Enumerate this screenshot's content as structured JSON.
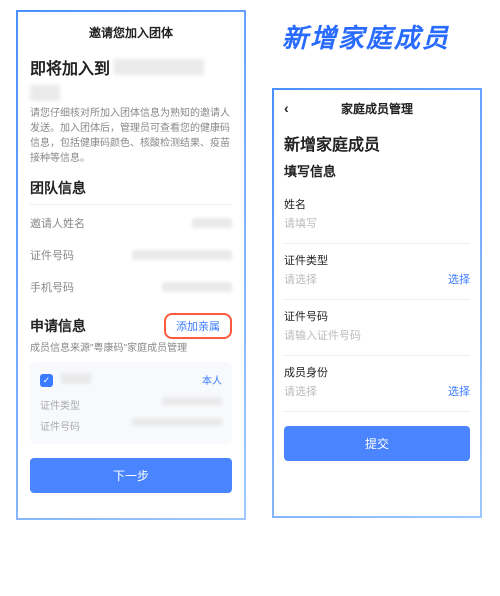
{
  "annotation_title": "新增家庭成员",
  "left": {
    "header": "邀请您加入团体",
    "join_prefix": "即将加入到",
    "join_target_blurred": "【粤省事APP演示】",
    "desc": "请您仔细核对所加入团体信息为熟知的邀请人发送。加入团体后，管理员可查看您的健康码信息，包括健康码颜色、核酸检测结果、疫苗接种等信息。",
    "team_section": "团队信息",
    "rows": {
      "inviter_label": "邀请人姓名",
      "idnum_label": "证件号码",
      "phone_label": "手机号码"
    },
    "apply_section": "申请信息",
    "apply_sub": "成员信息来源\"粤康码\"家庭成员管理",
    "add_relative": "添加亲属",
    "member": {
      "self_tag": "本人",
      "idtype_label": "证件类型",
      "idnum_label": "证件号码"
    },
    "next_btn": "下一步"
  },
  "right": {
    "header": "家庭成员管理",
    "title": "新增家庭成员",
    "subtitle": "填写信息",
    "fields": {
      "name_label": "姓名",
      "name_placeholder": "请填写",
      "idtype_label": "证件类型",
      "idtype_placeholder": "请选择",
      "idnum_label": "证件号码",
      "idnum_placeholder": "请输入证件号码",
      "role_label": "成员身份",
      "role_placeholder": "请选择",
      "select_action": "选择"
    },
    "submit_btn": "提交"
  }
}
